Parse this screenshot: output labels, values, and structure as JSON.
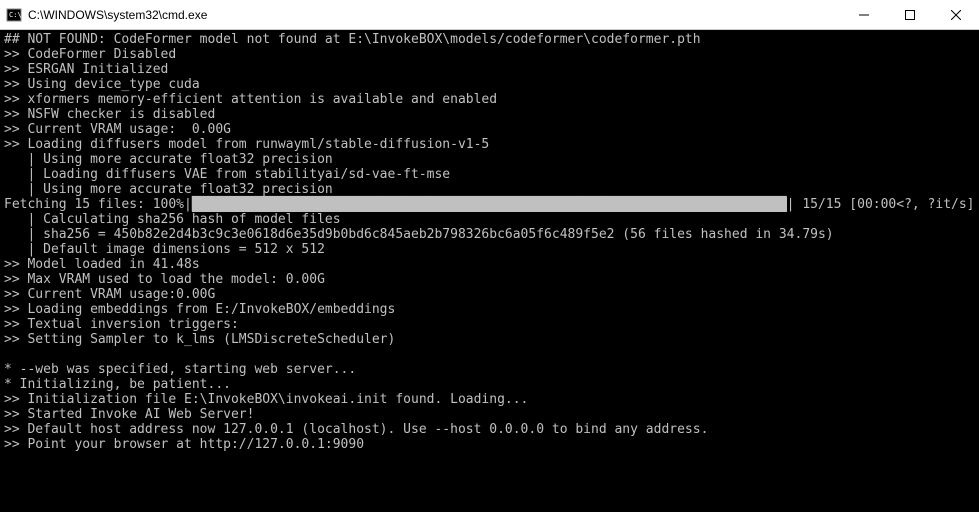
{
  "window": {
    "title": "C:\\WINDOWS\\system32\\cmd.exe"
  },
  "terminal": {
    "lines": [
      "## NOT FOUND: CodeFormer model not found at E:\\InvokeBOX\\models/codeformer\\codeformer.pth",
      ">> CodeFormer Disabled",
      ">> ESRGAN Initialized",
      ">> Using device_type cuda",
      ">> xformers memory-efficient attention is available and enabled",
      ">> NSFW checker is disabled",
      ">> Current VRAM usage:  0.00G",
      ">> Loading diffusers model from runwayml/stable-diffusion-v1-5",
      "   | Using more accurate float32 precision",
      "   | Loading diffusers VAE from stabilityai/sd-vae-ft-mse",
      "   | Using more accurate float32 precision"
    ],
    "progress": {
      "prefix": "Fetching 15 files: 100%|",
      "bar_fill": "████████████████████████████████████████████████████████████████████████████",
      "suffix": "| 15/15 [00:00<?, ?it/s]"
    },
    "lines2": [
      "   | Calculating sha256 hash of model files",
      "   | sha256 = 450b82e2d4b3c9c3e0618d6e35d9b0bd6c845aeb2b798326bc6a05f6c489f5e2 (56 files hashed in 34.79s)",
      "   | Default image dimensions = 512 x 512",
      ">> Model loaded in 41.48s",
      ">> Max VRAM used to load the model: 0.00G",
      ">> Current VRAM usage:0.00G",
      ">> Loading embeddings from E:/InvokeBOX/embeddings",
      ">> Textual inversion triggers:",
      ">> Setting Sampler to k_lms (LMSDiscreteScheduler)",
      "",
      "* --web was specified, starting web server...",
      "* Initializing, be patient...",
      ">> Initialization file E:\\InvokeBOX\\invokeai.init found. Loading...",
      ">> Started Invoke AI Web Server!",
      ">> Default host address now 127.0.0.1 (localhost). Use --host 0.0.0.0 to bind any address.",
      ">> Point your browser at http://127.0.0.1:9090"
    ]
  }
}
